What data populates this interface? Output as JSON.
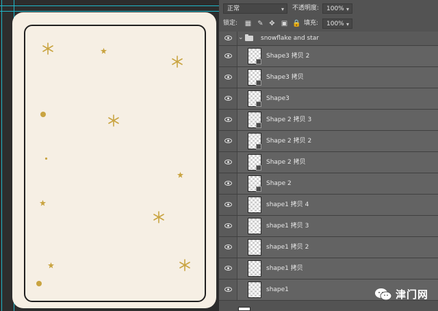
{
  "toolbar": {
    "blend_mode": "正常",
    "opacity_label": "不透明度:",
    "opacity_value": "100%",
    "lock_label": "锁定:",
    "fill_label": "填充:",
    "fill_value": "100%"
  },
  "group": {
    "name": "snowflake and star"
  },
  "layers": [
    {
      "name": "Shape3 拷贝 2"
    },
    {
      "name": "Shape3 拷贝"
    },
    {
      "name": "Shape3"
    },
    {
      "name": "Shape 2 拷贝 3"
    },
    {
      "name": "Shape 2 拷贝 2"
    },
    {
      "name": "Shape 2 拷贝"
    },
    {
      "name": "Shape 2"
    },
    {
      "name": "shape1 拷贝 4"
    },
    {
      "name": "shape1 拷贝 3"
    },
    {
      "name": "shape1 拷贝 2"
    },
    {
      "name": "shape1 拷贝"
    },
    {
      "name": "shape1"
    }
  ],
  "watermark": {
    "text": "津门网"
  },
  "icons": {
    "eye": "eye-icon",
    "folder": "folder-icon",
    "chevron": "chevron-down-icon",
    "lock_transparent": "lock-transparent-pixels-icon",
    "lock_image": "lock-image-pixels-icon",
    "lock_position": "lock-position-icon",
    "lock_artboard": "lock-artboard-icon",
    "lock_all": "lock-all-icon",
    "shape_badge": "shape-layer-icon"
  },
  "colors": {
    "card_background": "#f6efe4",
    "ornament_gold": "#c9a441",
    "panel_background": "#535353",
    "guide": "#1fb7c9"
  }
}
